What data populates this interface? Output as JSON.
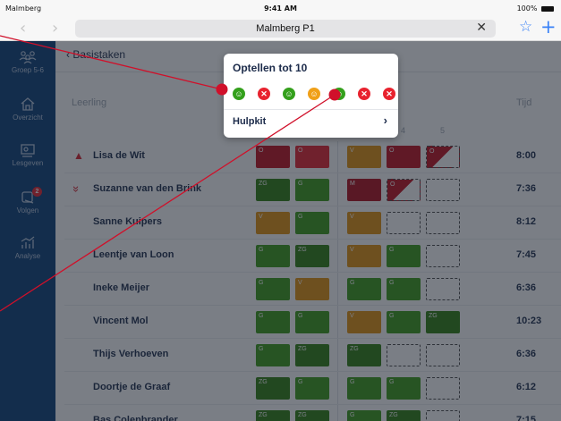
{
  "status": {
    "carrier": "Malmberg",
    "time": "9:41 AM",
    "battery": "100%"
  },
  "browser": {
    "url": "Malmberg P1",
    "back": "‹",
    "forward": "›",
    "clear": "✕",
    "bookmark": "☆",
    "add": "+"
  },
  "sidebar": {
    "items": [
      {
        "label": "Groep 5-6",
        "icon": "group-icon"
      },
      {
        "label": "Overzicht",
        "icon": "home-icon"
      },
      {
        "label": "Lesgeven",
        "icon": "teach-icon"
      },
      {
        "label": "Volgen",
        "icon": "follow-icon",
        "badge": "2"
      },
      {
        "label": "Analyse",
        "icon": "chart-icon"
      }
    ]
  },
  "page": {
    "back_label": "Basistaken"
  },
  "table": {
    "col_leerling": "Leerling",
    "col_tijd": "Tijd",
    "col_numbers": [
      "4",
      "5"
    ],
    "rows": [
      {
        "name": "Lisa de Wit",
        "time": "8:00",
        "flag": "triangle",
        "c1": "O",
        "c2": "O",
        "c3": "V",
        "c4": "O",
        "c5": "O"
      },
      {
        "name": "Suzanne van den Brink",
        "time": "7:36",
        "flag": "chevrons",
        "c1": "ZG",
        "c2": "G",
        "c3": "M",
        "c4": "O",
        "c5": ""
      },
      {
        "name": "Sanne Kuipers",
        "time": "8:12",
        "c1": "V",
        "c2": "G",
        "c3": "V",
        "c4": "",
        "c5": ""
      },
      {
        "name": "Leentje van Loon",
        "time": "7:45",
        "c1": "G",
        "c2": "ZG",
        "c3": "V",
        "c4": "G",
        "c5": ""
      },
      {
        "name": "Ineke Meijer",
        "time": "6:36",
        "c1": "G",
        "c2": "V",
        "c3": "G",
        "c4": "G",
        "c5": ""
      },
      {
        "name": "Vincent Mol",
        "time": "10:23",
        "c1": "G",
        "c2": "G",
        "c3": "V",
        "c4": "G",
        "c5": "ZG"
      },
      {
        "name": "Thijs Verhoeven",
        "time": "6:36",
        "c1": "G",
        "c2": "ZG",
        "c3": "ZG",
        "c4": "",
        "c5": ""
      },
      {
        "name": "Doortje de Graaf",
        "time": "6:12",
        "c1": "ZG",
        "c2": "G",
        "c3": "G",
        "c4": "G",
        "c5": ""
      },
      {
        "name": "Bas Colenbrander",
        "time": "7:15",
        "c1": "ZG",
        "c2": "ZG",
        "c3": "G",
        "c4": "ZG",
        "c5": ""
      }
    ]
  },
  "popover": {
    "title": "Optellen tot 10",
    "results": [
      "correct",
      "wrong",
      "correct",
      "half",
      "correct",
      "wrong",
      "wrong"
    ],
    "hulpkit_label": "Hulpkit",
    "chevron": "›"
  },
  "colors": {
    "sidebar": "#0b3e78",
    "green": "#3b9c17",
    "dark_green": "#2f7e10",
    "orange": "#e3920d",
    "red": "#c0101e",
    "highlight": "#e8222e",
    "annotation": "#d0102a"
  }
}
